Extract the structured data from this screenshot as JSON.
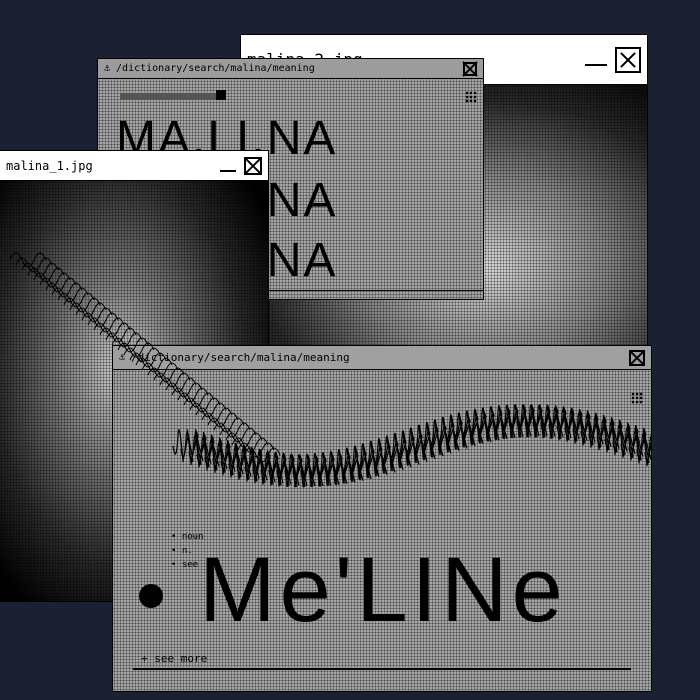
{
  "windows": {
    "image2": {
      "title": "malina_2.jpg"
    },
    "dict_back": {
      "address": "/dictionary/search/malina/meaning",
      "heading_lines": [
        "MA.LI.NA",
        "MA.LI.NA",
        "MA.LI.NA"
      ]
    },
    "image1": {
      "title": "malina_1.jpg"
    },
    "dict_front": {
      "address": "/dictionary/search/malina/meaning",
      "entry_bullets": [
        "noun",
        "n.",
        "see"
      ],
      "pronunciation": "Me'LINe",
      "see_more_label": "+ see more",
      "footer_left": "",
      "footer_center": "",
      "footer_right": ""
    }
  },
  "colors": {
    "background": "#1b2130",
    "window_fill": "#9a9a9a",
    "titlebar": "#ffffff",
    "ink": "#000000"
  },
  "icons": {
    "close": "close-x-box-icon",
    "minimize": "minimize-bar-icon",
    "menu": "dot-grid-icon"
  }
}
